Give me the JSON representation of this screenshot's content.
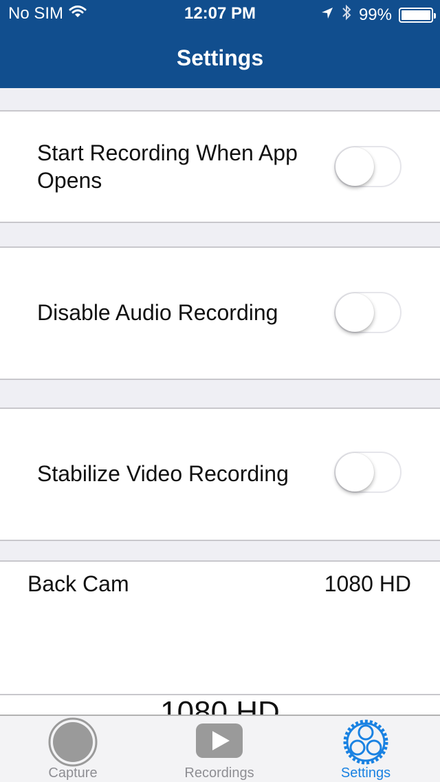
{
  "status_bar": {
    "carrier": "No SIM",
    "time": "12:07 PM",
    "battery_percent": "99%",
    "battery_level": 0.99
  },
  "nav": {
    "title": "Settings"
  },
  "settings": [
    {
      "label_line1": "Start Recording When App",
      "label_line2": "Opens",
      "enabled": false
    },
    {
      "label": "Disable Audio Recording",
      "enabled": false
    },
    {
      "label": "Stabilize Video Recording",
      "enabled": false
    }
  ],
  "camera": {
    "label": "Back Cam",
    "value": "1080 HD",
    "picker_value": "1080 HD"
  },
  "tabs": [
    {
      "label": "Capture",
      "icon": "capture-icon",
      "active": false
    },
    {
      "label": "Recordings",
      "icon": "play-icon",
      "active": false
    },
    {
      "label": "Settings",
      "icon": "gear-icon",
      "active": true
    }
  ],
  "colors": {
    "header": "#114e8e",
    "active_tab": "#1a82e2",
    "inactive_tab": "#8e8e93"
  }
}
